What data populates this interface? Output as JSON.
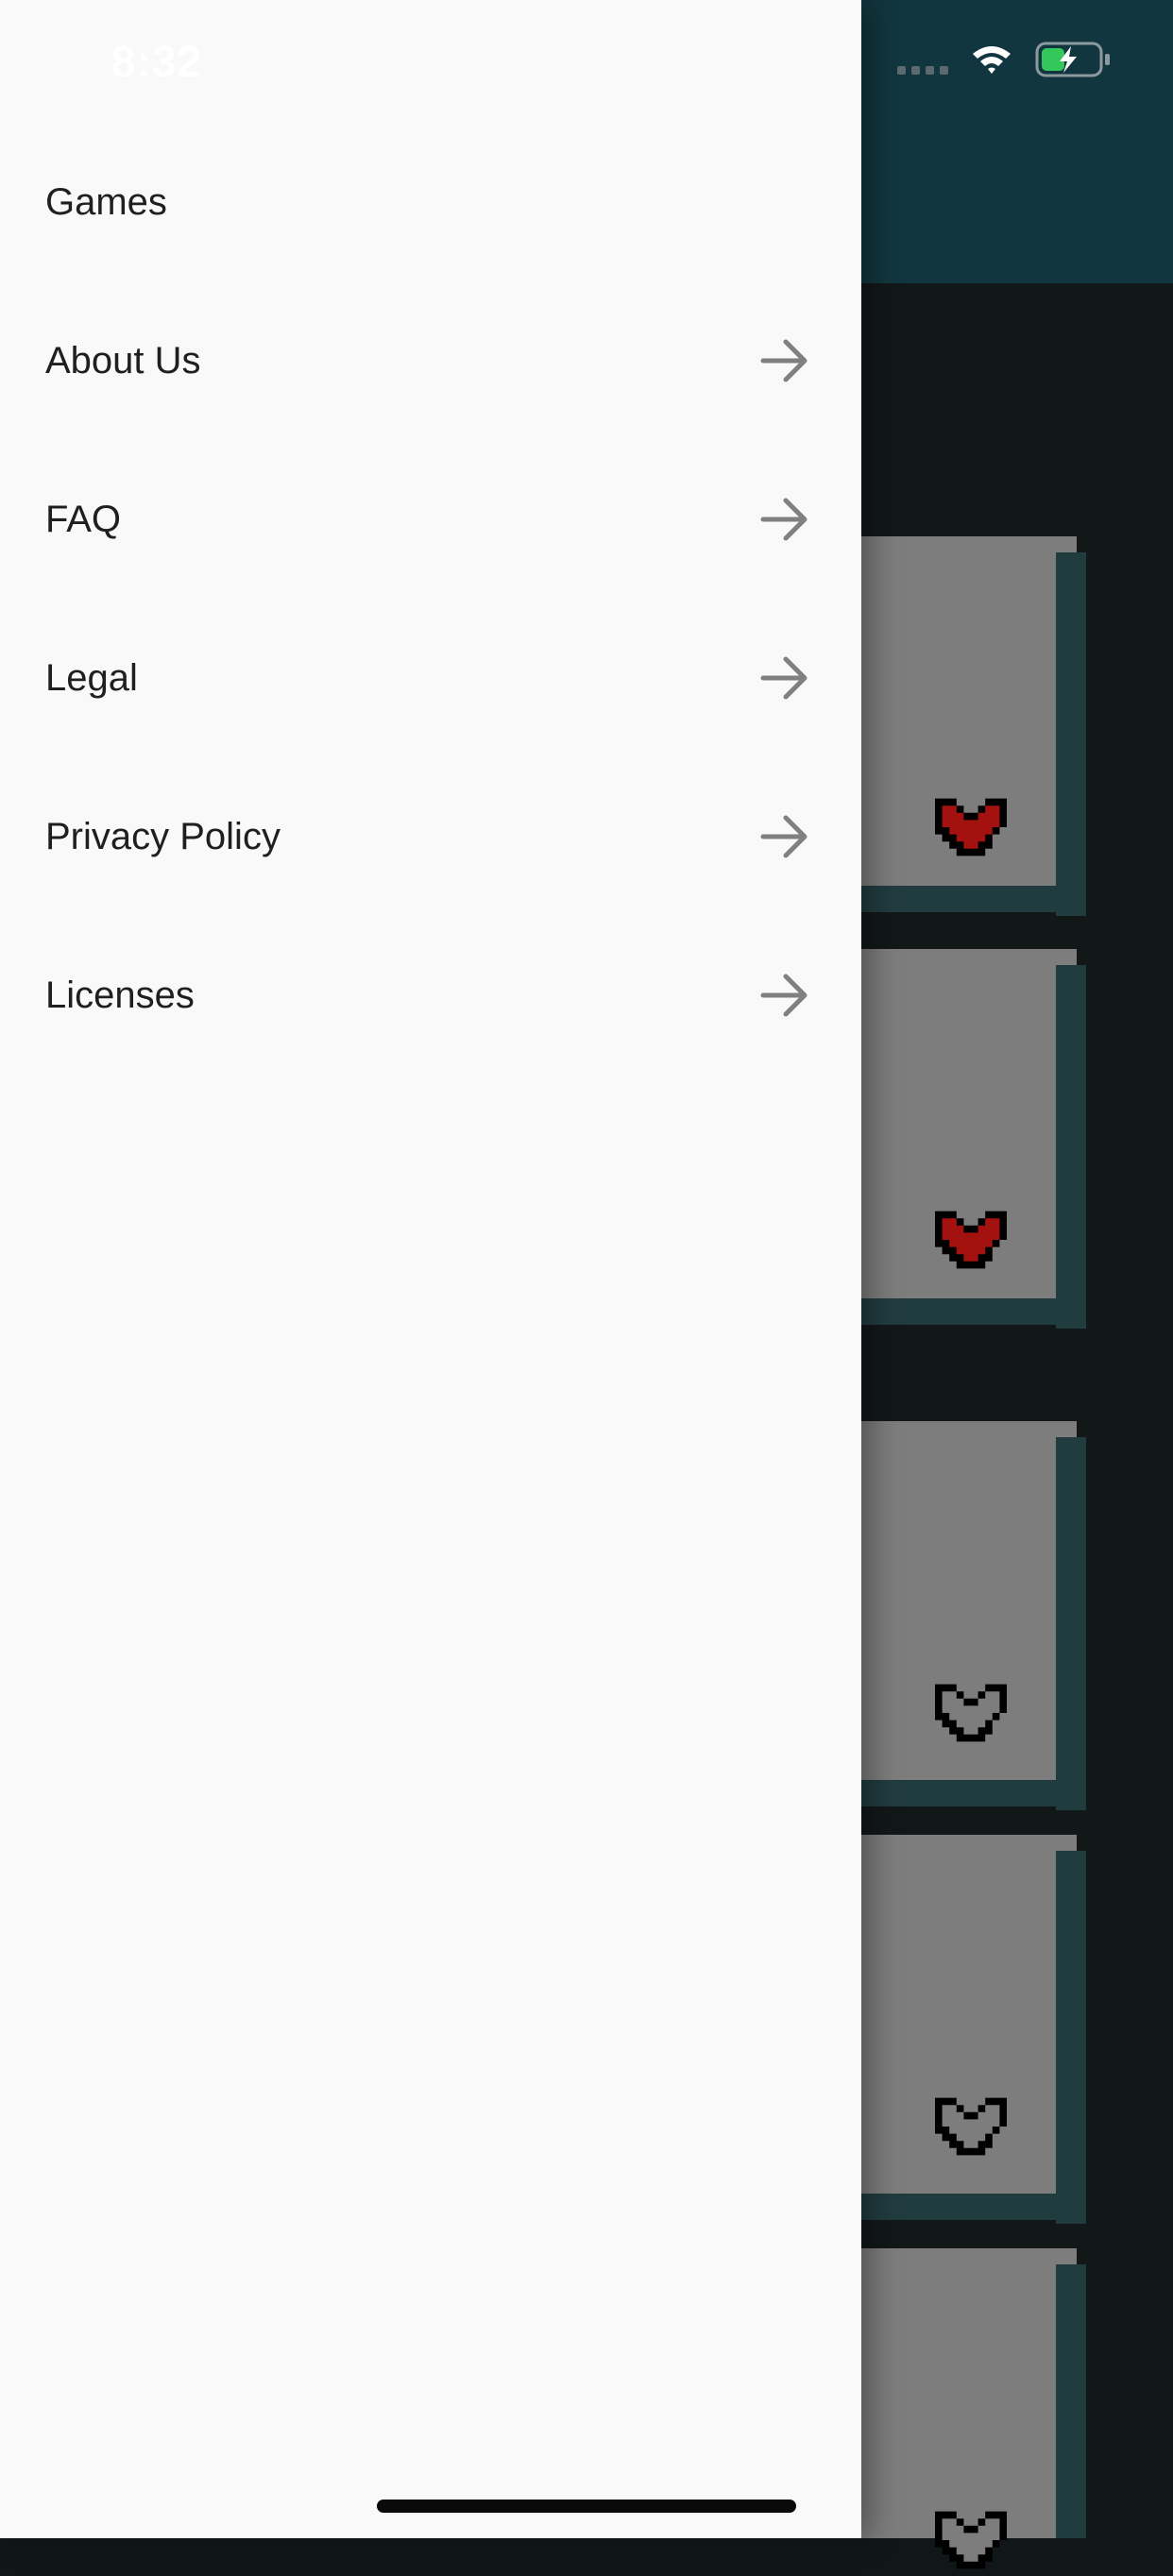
{
  "status_bar": {
    "time": "8:32",
    "wifi_icon": "wifi-icon",
    "battery_icon": "battery-charging-icon",
    "battery_color": "#34c759"
  },
  "background_app": {
    "header_color": "#12363f",
    "card_color": "#7d7d7d",
    "cards": [
      {
        "favorite": true
      },
      {
        "favorite": true
      },
      {
        "favorite": false
      },
      {
        "favorite": false
      },
      {
        "favorite": false
      }
    ]
  },
  "drawer": {
    "items": [
      {
        "label": "Games",
        "arrow": false
      },
      {
        "label": "About Us",
        "arrow": true,
        "icon": "arrow-right-icon"
      },
      {
        "label": "FAQ",
        "arrow": true,
        "icon": "arrow-right-icon"
      },
      {
        "label": "Legal",
        "arrow": true,
        "icon": "arrow-right-icon"
      },
      {
        "label": "Privacy Policy",
        "arrow": true,
        "icon": "arrow-right-icon"
      },
      {
        "label": "Licenses",
        "arrow": true,
        "icon": "arrow-right-icon"
      }
    ]
  }
}
